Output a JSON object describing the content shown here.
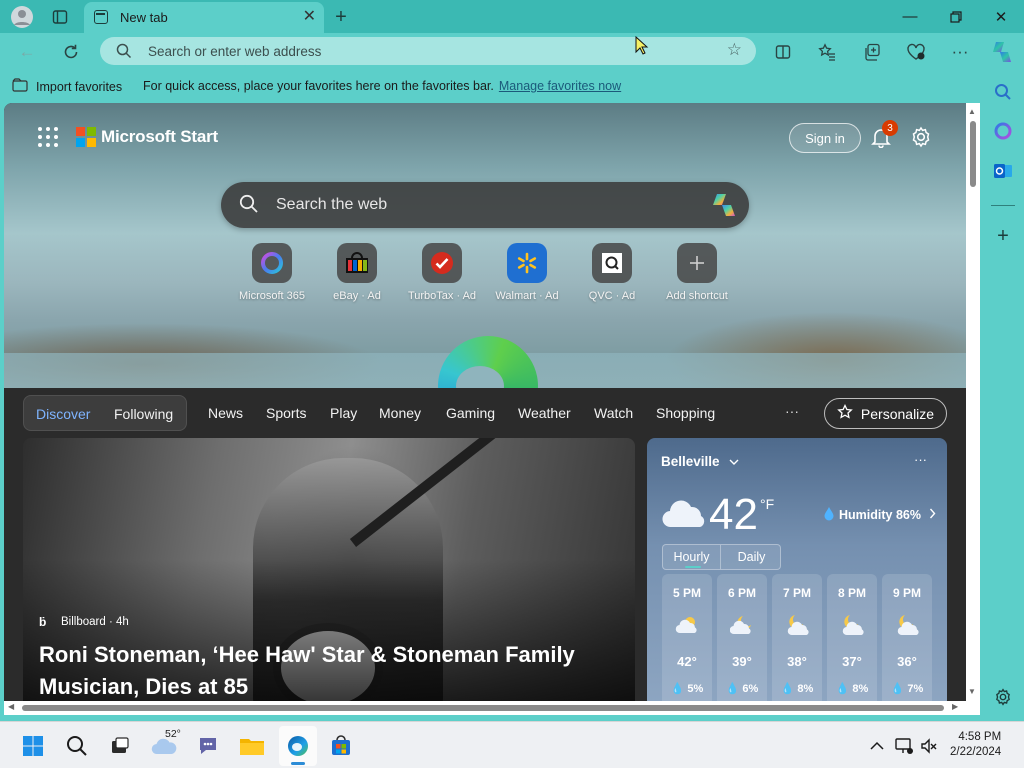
{
  "browser": {
    "tab_title": "New tab",
    "address_placeholder": "Search or enter web address",
    "favorites_bar": {
      "import_label": "Import favorites",
      "message": "For quick access, place your favorites here on the favorites bar.",
      "manage_link": "Manage favorites now"
    }
  },
  "header": {
    "brand": "Microsoft Start",
    "sign_in": "Sign in",
    "notification_count": "3"
  },
  "search": {
    "placeholder": "Search the web"
  },
  "shortcuts": [
    {
      "label": "Microsoft 365"
    },
    {
      "label": "eBay · Ad"
    },
    {
      "label": "TurboTax · Ad"
    },
    {
      "label": "Walmart · Ad"
    },
    {
      "label": "QVC · Ad"
    },
    {
      "label": "Add shortcut"
    }
  ],
  "feed_nav": {
    "discover": "Discover",
    "following": "Following",
    "links": [
      "News",
      "Sports",
      "Play",
      "Money",
      "Gaming",
      "Weather",
      "Watch",
      "Shopping"
    ],
    "more": "···",
    "personalize": "Personalize"
  },
  "story": {
    "source": "Billboard · 4h",
    "headline": "Roni Stoneman, ‘Hee Haw' Star & Stoneman Family Musician, Dies at 85"
  },
  "weather": {
    "city": "Belleville",
    "more": "···",
    "temp": "42",
    "unit": "°F",
    "humidity": "Humidity 86%",
    "tab_hourly": "Hourly",
    "tab_daily": "Daily",
    "hours": [
      {
        "time": "5 PM",
        "temp": "42°",
        "precip": "5%",
        "icon": "cloudy"
      },
      {
        "time": "6 PM",
        "temp": "39°",
        "precip": "6%",
        "icon": "partly-cloudy-night"
      },
      {
        "time": "7 PM",
        "temp": "38°",
        "precip": "8%",
        "icon": "partly-cloudy-night"
      },
      {
        "time": "8 PM",
        "temp": "37°",
        "precip": "8%",
        "icon": "partly-cloudy-night"
      },
      {
        "time": "9 PM",
        "temp": "36°",
        "precip": "7%",
        "icon": "partly-cloudy-night"
      }
    ]
  },
  "taskbar": {
    "weather_temp": "52°",
    "time": "4:58 PM",
    "date": "2/22/2024"
  },
  "colors": {
    "accent_teal": "#5ccfc9",
    "titlebar": "#3bb9b3",
    "notification_badge": "#d83b01",
    "discover_active": "#7fb4ff"
  }
}
